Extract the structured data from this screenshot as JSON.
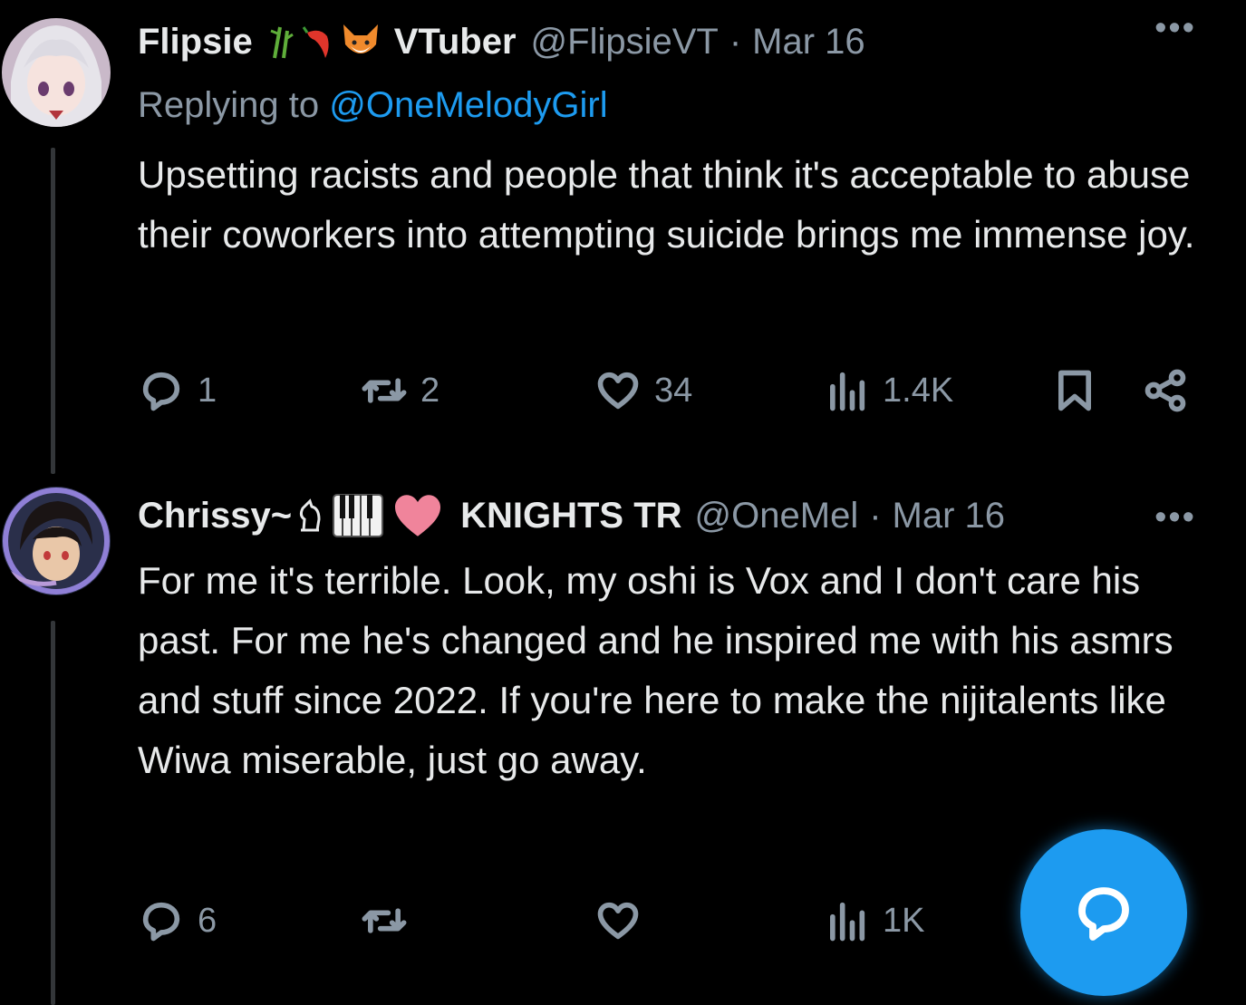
{
  "tweets": [
    {
      "display_name": "Flipsie",
      "name_suffix": "VTuber",
      "handle": "@FlipsieVT",
      "date": "Mar 16",
      "replying_prefix": "Replying to ",
      "replying_to": "@OneMelodyGirl",
      "text": "Upsetting racists and people that think it's acceptable to abuse their coworkers into attempting suicide brings me immense joy.",
      "replies": "1",
      "retweets": "2",
      "likes": "34",
      "views": "1.4K"
    },
    {
      "display_name": "Chrissy~",
      "name_suffix": "KNIGHTS TR",
      "handle": "@OneMel",
      "date": "Mar 16",
      "text": "For me it's terrible. Look, my oshi is Vox and I don't care his past. For me he's changed and he inspired me with his asmrs and stuff since 2022. If you're here to make the nijitalents like Wiwa miserable, just go away.",
      "replies": "6",
      "retweets": "",
      "likes": "",
      "views": "1K"
    }
  ],
  "ui": {
    "more_label": "•••",
    "dot": "·",
    "accent_color": "#1d9bf0",
    "icons": [
      "reply-icon",
      "retweet-icon",
      "like-icon",
      "views-icon",
      "bookmark-icon",
      "share-icon",
      "compose-reply-icon"
    ]
  }
}
